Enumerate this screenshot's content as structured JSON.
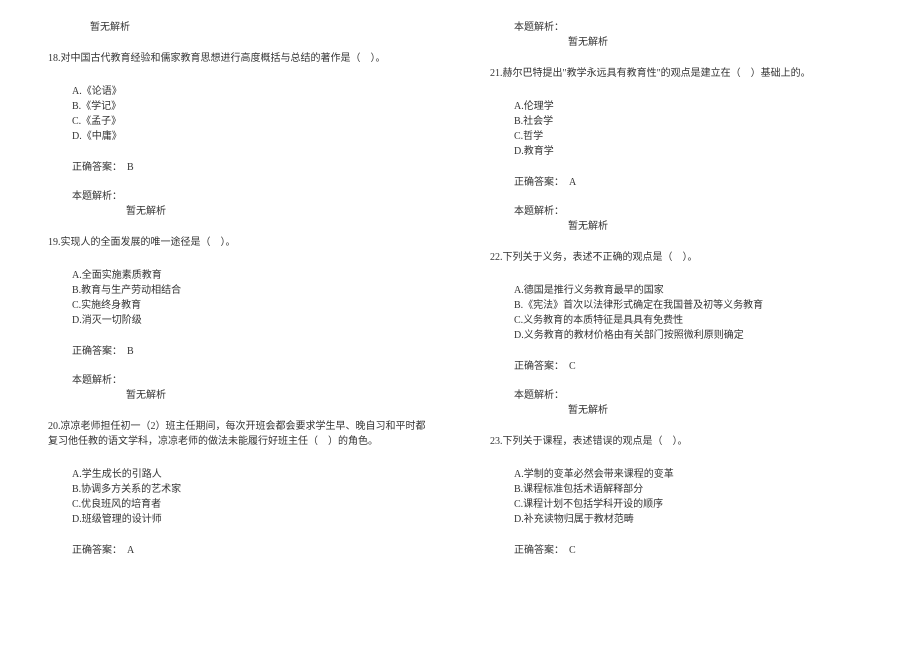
{
  "left": {
    "top_no_analysis": "暂无解析",
    "q18": {
      "stem": "18.对中国古代教育经验和儒家教育思想进行高度概括与总结的著作是（　）。",
      "opt_a": "A.《论语》",
      "opt_b": "B.《学记》",
      "opt_c": "C.《孟子》",
      "opt_d": "D.《中庸》",
      "answer": "正确答案：　B",
      "analysis_header": "本题解析：",
      "analysis_content": "暂无解析"
    },
    "q19": {
      "stem": "19.实现人的全面发展的唯一途径是（　）。",
      "opt_a": "A.全面实施素质教育",
      "opt_b": "B.教育与生产劳动相结合",
      "opt_c": "C.实施终身教育",
      "opt_d": "D.消灭一切阶级",
      "answer": "正确答案：　B",
      "analysis_header": "本题解析：",
      "analysis_content": "暂无解析"
    },
    "q20": {
      "stem": "20.凉凉老师担任初一（2）班主任期间，每次开班会都会要求学生早、晚自习和平时都复习他任教的语文学科，凉凉老师的做法未能履行好班主任（　）的角色。",
      "opt_a": "A.学生成长的引路人",
      "opt_b": "B.协调多方关系的艺术家",
      "opt_c": "C.优良班风的培育者",
      "opt_d": "D.班级管理的设计师",
      "answer": "正确答案：　A"
    }
  },
  "right": {
    "top": {
      "analysis_header": "本题解析：",
      "analysis_content": "暂无解析"
    },
    "q21": {
      "stem": "21.赫尔巴特提出\"教学永远具有教育性\"的观点是建立在（　）基础上的。",
      "opt_a": "A.伦理学",
      "opt_b": "B.社会学",
      "opt_c": "C.哲学",
      "opt_d": "D.教育学",
      "answer": "正确答案：　A",
      "analysis_header": "本题解析：",
      "analysis_content": "暂无解析"
    },
    "q22": {
      "stem": "22.下列关于义务，表述不正确的观点是（　）。",
      "opt_a": "A.德国是推行义务教育最早的国家",
      "opt_b": "B.《宪法》首次以法律形式确定在我国普及初等义务教育",
      "opt_c": "C.义务教育的本质特征是具具有免费性",
      "opt_d": "D.义务教育的教材价格由有关部门按照微利原则确定",
      "answer": "正确答案：　C",
      "analysis_header": "本题解析：",
      "analysis_content": "暂无解析"
    },
    "q23": {
      "stem": "23.下列关于课程，表述错误的观点是（　）。",
      "opt_a": "A.学制的变革必然会带来课程的变革",
      "opt_b": "B.课程标准包括术语解释部分",
      "opt_c": "C.课程计划不包括学科开设的顺序",
      "opt_d": "D.补充读物归属于教材范畴",
      "answer": "正确答案：　C"
    }
  }
}
